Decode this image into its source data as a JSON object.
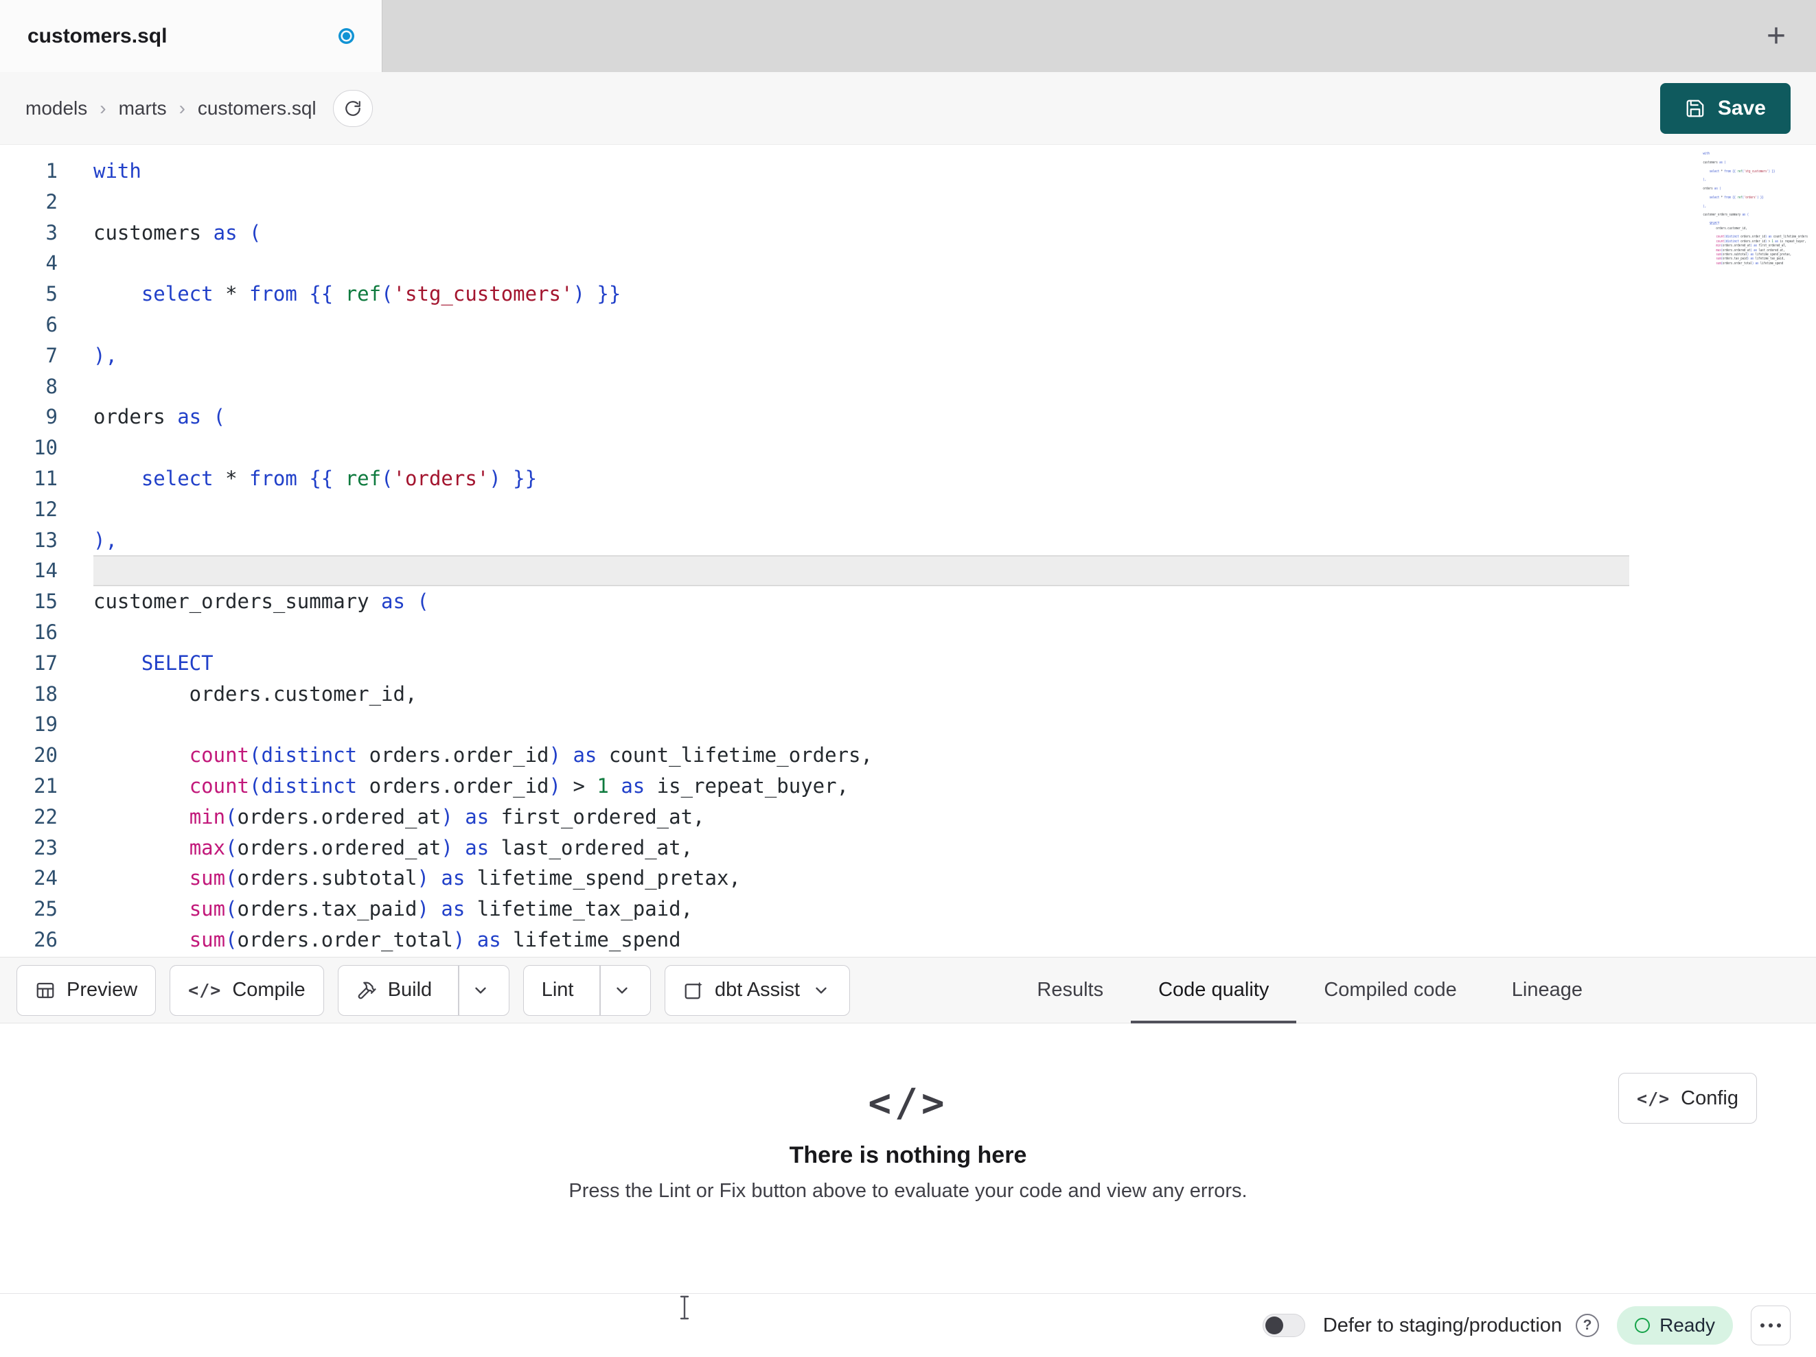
{
  "tab": {
    "title": "customers.sql",
    "unsaved": true
  },
  "breadcrumb": {
    "items": [
      "models",
      "marts",
      "customers.sql"
    ]
  },
  "save": {
    "label": "Save"
  },
  "icons": {
    "plus_glyph": "+",
    "breadcrumb_sep_glyph": "›",
    "code_glyph": "</>",
    "help_glyph": "?"
  },
  "editor": {
    "current_line": 14,
    "lines": [
      {
        "n": 1,
        "t": [
          [
            "k",
            "with"
          ]
        ]
      },
      {
        "n": 2,
        "t": []
      },
      {
        "n": 3,
        "t": [
          [
            "d",
            "customers "
          ],
          [
            "k",
            "as"
          ],
          [
            "d",
            " "
          ],
          [
            "p",
            "("
          ]
        ]
      },
      {
        "n": 4,
        "t": []
      },
      {
        "n": 5,
        "t": [
          [
            "d",
            "    "
          ],
          [
            "k",
            "select"
          ],
          [
            "d",
            " * "
          ],
          [
            "k",
            "from"
          ],
          [
            "d",
            " "
          ],
          [
            "p",
            "{{ "
          ],
          [
            "g",
            "ref"
          ],
          [
            "p",
            "("
          ],
          [
            "s",
            "'stg_customers'"
          ],
          [
            "p",
            ")"
          ],
          [
            "p",
            " }}"
          ]
        ]
      },
      {
        "n": 6,
        "t": []
      },
      {
        "n": 7,
        "t": [
          [
            "p",
            "),"
          ]
        ]
      },
      {
        "n": 8,
        "t": []
      },
      {
        "n": 9,
        "t": [
          [
            "d",
            "orders "
          ],
          [
            "k",
            "as"
          ],
          [
            "d",
            " "
          ],
          [
            "p",
            "("
          ]
        ]
      },
      {
        "n": 10,
        "t": []
      },
      {
        "n": 11,
        "t": [
          [
            "d",
            "    "
          ],
          [
            "k",
            "select"
          ],
          [
            "d",
            " * "
          ],
          [
            "k",
            "from"
          ],
          [
            "d",
            " "
          ],
          [
            "p",
            "{{ "
          ],
          [
            "g",
            "ref"
          ],
          [
            "p",
            "("
          ],
          [
            "s",
            "'orders'"
          ],
          [
            "p",
            ")"
          ],
          [
            "p",
            " }}"
          ]
        ]
      },
      {
        "n": 12,
        "t": []
      },
      {
        "n": 13,
        "t": [
          [
            "p",
            "),"
          ]
        ]
      },
      {
        "n": 14,
        "t": [],
        "current": true
      },
      {
        "n": 15,
        "t": [
          [
            "d",
            "customer_orders_summary "
          ],
          [
            "k",
            "as"
          ],
          [
            "d",
            " "
          ],
          [
            "p",
            "("
          ]
        ]
      },
      {
        "n": 16,
        "t": []
      },
      {
        "n": 17,
        "t": [
          [
            "d",
            "    "
          ],
          [
            "k",
            "SELECT"
          ]
        ]
      },
      {
        "n": 18,
        "t": [
          [
            "d",
            "        orders.customer_id,"
          ]
        ]
      },
      {
        "n": 19,
        "t": []
      },
      {
        "n": 20,
        "t": [
          [
            "d",
            "        "
          ],
          [
            "f",
            "count"
          ],
          [
            "p",
            "("
          ],
          [
            "k",
            "distinct"
          ],
          [
            "d",
            " orders.order_id"
          ],
          [
            "p",
            ")"
          ],
          [
            "d",
            " "
          ],
          [
            "k",
            "as"
          ],
          [
            "d",
            " count_lifetime_orders,"
          ]
        ]
      },
      {
        "n": 21,
        "t": [
          [
            "d",
            "        "
          ],
          [
            "f",
            "count"
          ],
          [
            "p",
            "("
          ],
          [
            "k",
            "distinct"
          ],
          [
            "d",
            " orders.order_id"
          ],
          [
            "p",
            ")"
          ],
          [
            "d",
            " > "
          ],
          [
            "n",
            "1"
          ],
          [
            "d",
            " "
          ],
          [
            "k",
            "as"
          ],
          [
            "d",
            " is_repeat_buyer,"
          ]
        ]
      },
      {
        "n": 22,
        "t": [
          [
            "d",
            "        "
          ],
          [
            "f",
            "min"
          ],
          [
            "p",
            "("
          ],
          [
            "d",
            "orders.ordered_at"
          ],
          [
            "p",
            ")"
          ],
          [
            "d",
            " "
          ],
          [
            "k",
            "as"
          ],
          [
            "d",
            " first_ordered_at,"
          ]
        ]
      },
      {
        "n": 23,
        "t": [
          [
            "d",
            "        "
          ],
          [
            "f",
            "max"
          ],
          [
            "p",
            "("
          ],
          [
            "d",
            "orders.ordered_at"
          ],
          [
            "p",
            ")"
          ],
          [
            "d",
            " "
          ],
          [
            "k",
            "as"
          ],
          [
            "d",
            " last_ordered_at,"
          ]
        ]
      },
      {
        "n": 24,
        "t": [
          [
            "d",
            "        "
          ],
          [
            "f",
            "sum"
          ],
          [
            "p",
            "("
          ],
          [
            "d",
            "orders.subtotal"
          ],
          [
            "p",
            ")"
          ],
          [
            "d",
            " "
          ],
          [
            "k",
            "as"
          ],
          [
            "d",
            " lifetime_spend_pretax,"
          ]
        ]
      },
      {
        "n": 25,
        "t": [
          [
            "d",
            "        "
          ],
          [
            "f",
            "sum"
          ],
          [
            "p",
            "("
          ],
          [
            "d",
            "orders.tax_paid"
          ],
          [
            "p",
            ")"
          ],
          [
            "d",
            " "
          ],
          [
            "k",
            "as"
          ],
          [
            "d",
            " lifetime_tax_paid,"
          ]
        ]
      },
      {
        "n": 26,
        "t": [
          [
            "d",
            "        "
          ],
          [
            "f",
            "sum"
          ],
          [
            "p",
            "("
          ],
          [
            "d",
            "orders.order_total"
          ],
          [
            "p",
            ")"
          ],
          [
            "d",
            " "
          ],
          [
            "k",
            "as"
          ],
          [
            "d",
            " lifetime_spend"
          ]
        ]
      }
    ]
  },
  "toolbar": {
    "preview_label": "Preview",
    "compile_label": "Compile",
    "build_label": "Build",
    "lint_label": "Lint",
    "assist_label": "dbt Assist",
    "tabs": [
      {
        "label": "Results",
        "active": false
      },
      {
        "label": "Code quality",
        "active": true
      },
      {
        "label": "Compiled code",
        "active": false
      },
      {
        "label": "Lineage",
        "active": false
      }
    ]
  },
  "empty_state": {
    "title": "There is nothing here",
    "subtitle": "Press the Lint or Fix button above to evaluate your code and view any errors.",
    "config_label": "Config"
  },
  "statusbar": {
    "defer_label": "Defer to staging/production",
    "ready_label": "Ready"
  },
  "colors": {
    "save_button": "#0f5a5e",
    "tab_unsaved_dot": "#1193d4",
    "ready_badge_bg": "#d8f3e3",
    "ready_icon": "#16a34a",
    "active_tab_underline": "#52525b",
    "syntax": {
      "keyword": "#2140c9",
      "function": "#c2187a",
      "string": "#a3142e",
      "number": "#0e7a3e",
      "jinja_ref": "#0e7a3e",
      "punctuation": "#2140c9",
      "text": "#24292e",
      "line_number": "#2e4f6e",
      "active_line_bg": "#ededed"
    }
  }
}
